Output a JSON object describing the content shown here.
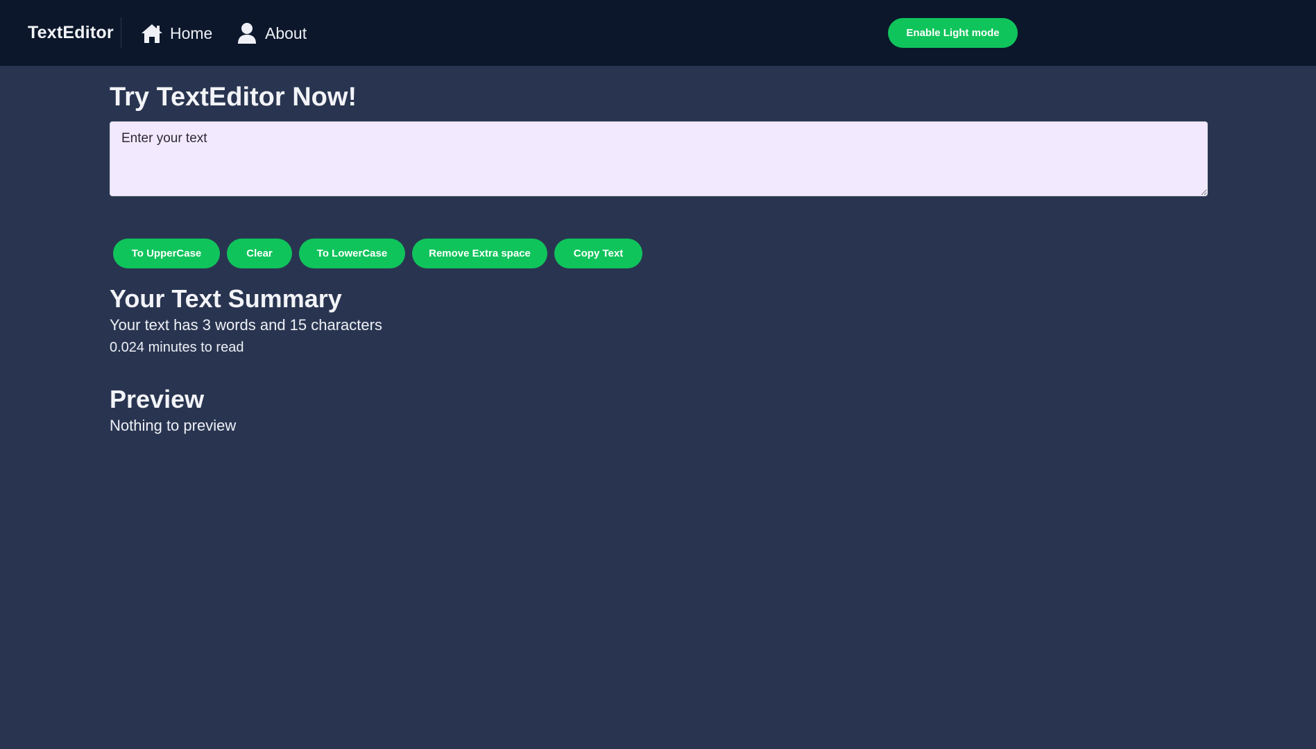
{
  "navbar": {
    "brand": "TextEditor",
    "items": [
      {
        "label": "Home",
        "icon": "home-icon"
      },
      {
        "label": "About",
        "icon": "user-icon"
      }
    ],
    "mode_button": "Enable Light mode"
  },
  "main": {
    "title": "Try TextEditor Now!",
    "textarea": {
      "value": "",
      "placeholder": "Enter your text"
    },
    "buttons": {
      "uppercase": "To UpperCase",
      "clear": "Clear",
      "lowercase": "To LowerCase",
      "remove_space": "Remove Extra space",
      "copy": "Copy Text"
    },
    "summary": {
      "heading": "Your Text Summary",
      "counts": "Your text has 3 words and 15 characters",
      "read_time": "0.024 minutes to read"
    },
    "preview": {
      "heading": "Preview",
      "text": "Nothing to preview"
    }
  },
  "colors": {
    "background": "#293550",
    "navbar": "#0c172b",
    "accent": "#10c45c",
    "textarea_bg": "#f3e9fe"
  }
}
